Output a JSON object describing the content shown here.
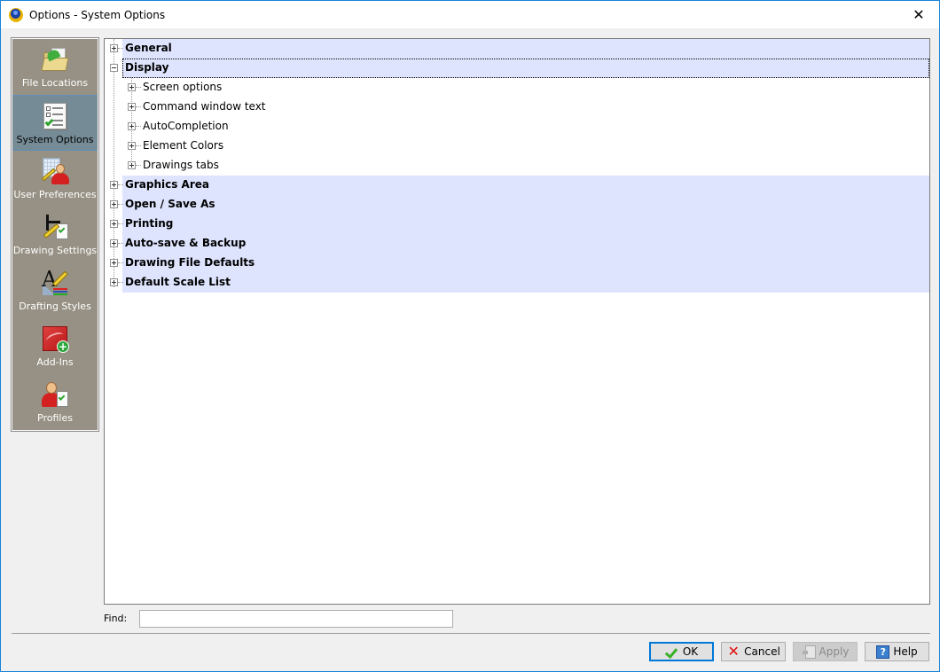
{
  "window": {
    "title": "Options - System Options",
    "close_glyph": "✕"
  },
  "sidebar": {
    "items": [
      {
        "label": "File Locations",
        "icon": "folder-arrow-icon",
        "active": false
      },
      {
        "label": "System Options",
        "icon": "checklist-icon",
        "active": true
      },
      {
        "label": "User Preferences",
        "icon": "user-preferences-icon",
        "active": false
      },
      {
        "label": "Drawing Settings",
        "icon": "drawing-settings-icon",
        "active": false
      },
      {
        "label": "Drafting Styles",
        "icon": "drafting-styles-icon",
        "active": false
      },
      {
        "label": "Add-Ins",
        "icon": "add-ins-icon",
        "active": false
      },
      {
        "label": "Profiles",
        "icon": "profiles-icon",
        "active": false
      }
    ]
  },
  "tree": {
    "nodes": [
      {
        "label": "General",
        "level": 0,
        "expanded": false,
        "bold": true
      },
      {
        "label": "Display",
        "level": 0,
        "expanded": true,
        "bold": true,
        "focused": true
      },
      {
        "label": "Screen options",
        "level": 1,
        "expanded": false,
        "bold": false
      },
      {
        "label": "Command window text",
        "level": 1,
        "expanded": false,
        "bold": false
      },
      {
        "label": "AutoCompletion",
        "level": 1,
        "expanded": false,
        "bold": false
      },
      {
        "label": "Element Colors",
        "level": 1,
        "expanded": false,
        "bold": false
      },
      {
        "label": "Drawings tabs",
        "level": 1,
        "expanded": false,
        "bold": false
      },
      {
        "label": "Graphics Area",
        "level": 0,
        "expanded": false,
        "bold": true
      },
      {
        "label": "Open / Save As",
        "level": 0,
        "expanded": false,
        "bold": true
      },
      {
        "label": "Printing",
        "level": 0,
        "expanded": false,
        "bold": true
      },
      {
        "label": "Auto-save & Backup",
        "level": 0,
        "expanded": false,
        "bold": true
      },
      {
        "label": "Drawing File Defaults",
        "level": 0,
        "expanded": false,
        "bold": true
      },
      {
        "label": "Default Scale List",
        "level": 0,
        "expanded": false,
        "bold": true
      }
    ]
  },
  "find": {
    "label": "Find:",
    "value": "",
    "placeholder": ""
  },
  "buttons": {
    "ok": "OK",
    "cancel": "Cancel",
    "apply": "Apply",
    "help": "Help",
    "help_glyph": "?",
    "cancel_glyph": "✕"
  },
  "colors": {
    "sidebar_bg": "#969184",
    "sidebar_active": "#758b95",
    "tree_highlight": "#dfe4fe",
    "accent": "#0078d7"
  }
}
